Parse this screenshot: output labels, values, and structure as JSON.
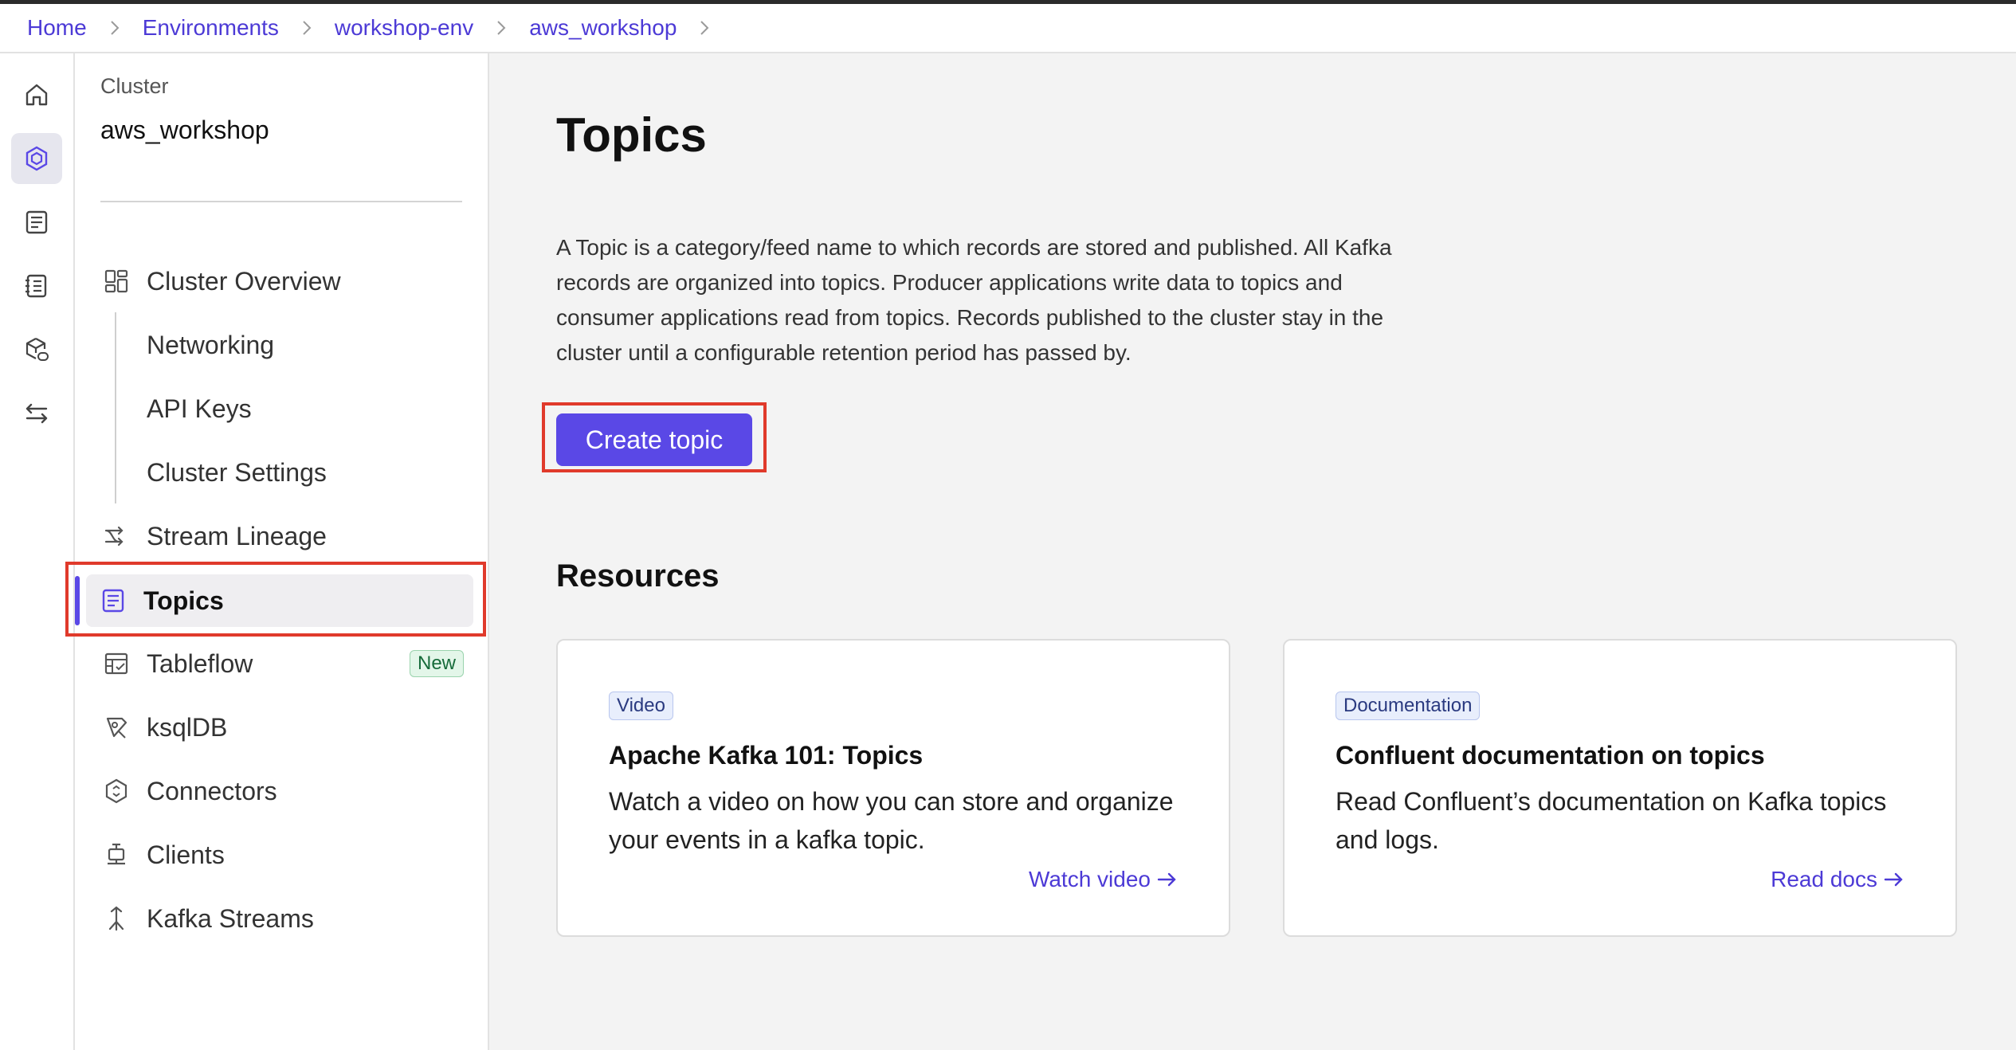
{
  "breadcrumb": {
    "items": [
      "Home",
      "Environments",
      "workshop-env",
      "aws_workshop"
    ]
  },
  "rail": {
    "icons": [
      "home-icon",
      "cluster-icon",
      "topics-icon",
      "schema-icon",
      "data-portal-icon",
      "transfer-icon"
    ]
  },
  "sidenav": {
    "cluster_label": "Cluster",
    "cluster_name": "aws_workshop",
    "items": {
      "overview": "Cluster Overview",
      "networking": "Networking",
      "api_keys": "API Keys",
      "settings": "Cluster Settings",
      "lineage": "Stream Lineage",
      "topics": "Topics",
      "tableflow": "Tableflow",
      "tableflow_badge": "New",
      "ksqldb": "ksqlDB",
      "connectors": "Connectors",
      "clients": "Clients",
      "kafka_streams": "Kafka Streams"
    }
  },
  "main": {
    "title": "Topics",
    "description": "A Topic is a category/feed name to which records are stored and published. All Kafka records are organized into topics. Producer applications write data to topics and consumer applications read from topics. Records published to the cluster stay in the cluster until a configurable retention period has passed by.",
    "create_button": "Create topic",
    "resources_title": "Resources",
    "cards": [
      {
        "tag": "Video",
        "title": "Apache Kafka 101: Topics",
        "description": "Watch a video on how you can store and organize your events in a kafka topic.",
        "link": "Watch video"
      },
      {
        "tag": "Documentation",
        "title": "Confluent documentation on topics",
        "description": "Read Confluent’s documentation on Kafka topics and logs.",
        "link": "Read docs"
      }
    ]
  },
  "colors": {
    "accent": "#5a48e6",
    "link": "#4c3ad6",
    "highlight": "#e03a2b"
  }
}
